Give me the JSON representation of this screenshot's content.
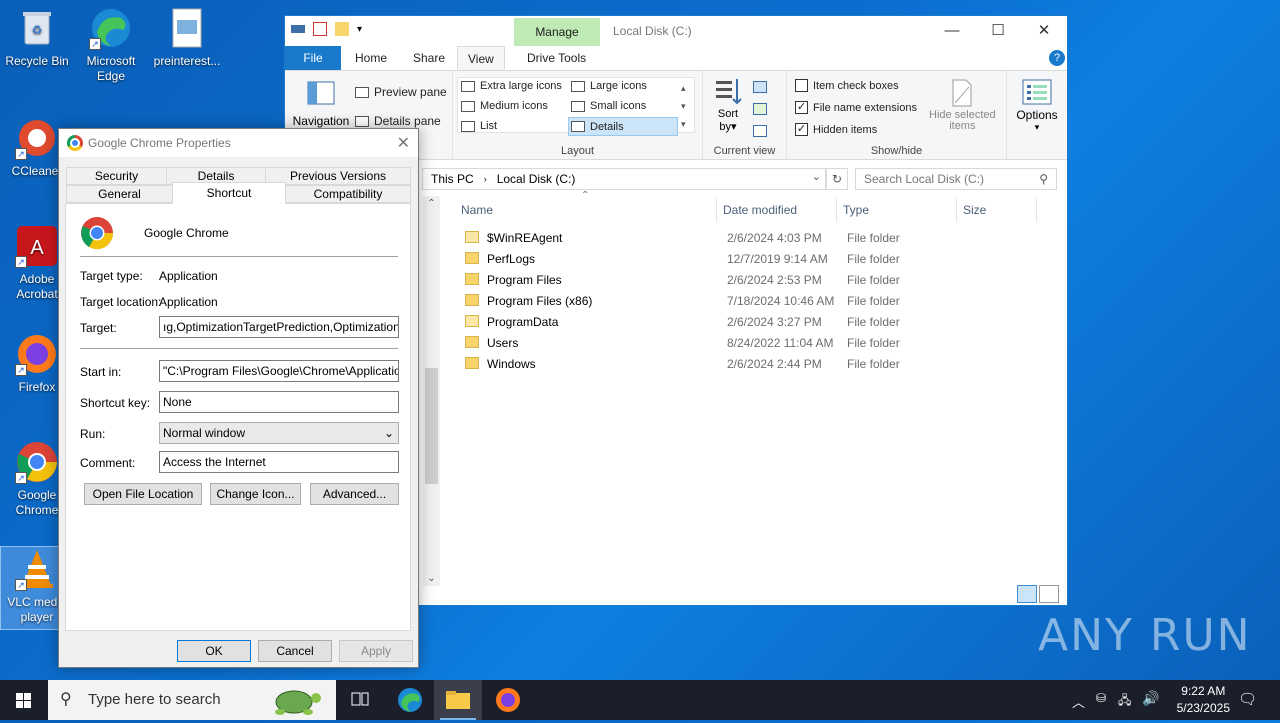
{
  "desktop": {
    "icons": [
      {
        "label": "Recycle Bin"
      },
      {
        "label": "Microsoft Edge"
      },
      {
        "label": "preinterest..."
      },
      {
        "label": "CCleaner"
      },
      {
        "label": "Adobe Acrobat"
      },
      {
        "label": "Firefox"
      },
      {
        "label": "Google Chrome"
      },
      {
        "label": "VLC media player"
      }
    ]
  },
  "explorer": {
    "title": "Local Disk (C:)",
    "manage_tab": "Manage",
    "tabs": [
      "File",
      "Home",
      "Share",
      "View",
      "Drive Tools"
    ],
    "active_tab": "View",
    "ribbon": {
      "panes": {
        "navigation": "Navigation",
        "preview": "Preview pane",
        "details": "Details pane"
      },
      "layout": {
        "label": "Layout",
        "items": [
          "Extra large icons",
          "Large icons",
          "Medium icons",
          "Small icons",
          "List",
          "Details"
        ],
        "selected": "Details"
      },
      "current_view": {
        "label": "Current view",
        "sort": "Sort",
        "sort_by": "by"
      },
      "show_hide": {
        "label": "Show/hide",
        "item_check_boxes": "Item check boxes",
        "file_name_extensions": "File name extensions",
        "hidden_items": "Hidden items",
        "hide_selected": "Hide selected",
        "hide_selected_2": "items",
        "checks": {
          "item_check_boxes": false,
          "file_name_extensions": true,
          "hidden_items": true
        }
      },
      "options": "Options"
    },
    "address": {
      "crumbs": [
        "This PC",
        "Local Disk (C:)"
      ]
    },
    "search_placeholder": "Search Local Disk (C:)",
    "columns": [
      "Name",
      "Date modified",
      "Type",
      "Size"
    ],
    "files": [
      {
        "name": "$WinREAgent",
        "date": "2/6/2024 4:03 PM",
        "type": "File folder",
        "hidden": true
      },
      {
        "name": "PerfLogs",
        "date": "12/7/2019 9:14 AM",
        "type": "File folder",
        "hidden": false
      },
      {
        "name": "Program Files",
        "date": "2/6/2024 2:53 PM",
        "type": "File folder",
        "hidden": false
      },
      {
        "name": "Program Files (x86)",
        "date": "7/18/2024 10:46 AM",
        "type": "File folder",
        "hidden": false
      },
      {
        "name": "ProgramData",
        "date": "2/6/2024 3:27 PM",
        "type": "File folder",
        "hidden": true
      },
      {
        "name": "Users",
        "date": "8/24/2022 11:04 AM",
        "type": "File folder",
        "hidden": false
      },
      {
        "name": "Windows",
        "date": "2/6/2024 2:44 PM",
        "type": "File folder",
        "hidden": false
      }
    ]
  },
  "dialog": {
    "title": "Google Chrome Properties",
    "tabs_row1": [
      "Security",
      "Details",
      "Previous Versions"
    ],
    "tabs_row2": [
      "General",
      "Shortcut",
      "Compatibility"
    ],
    "active_tab": "Shortcut",
    "app_name": "Google Chrome",
    "target_type_label": "Target type:",
    "target_type": "Application",
    "target_location_label": "Target location:",
    "target_location": "Application",
    "target_label": "Target:",
    "target": "ıg,OptimizationTargetPrediction,OptimizationHints\"",
    "start_in_label": "Start in:",
    "start_in": "\"C:\\Program Files\\Google\\Chrome\\Application\"",
    "shortcut_key_label": "Shortcut key:",
    "shortcut_key": "None",
    "run_label": "Run:",
    "run": "Normal window",
    "comment_label": "Comment:",
    "comment": "Access the Internet",
    "buttons": {
      "open_location": "Open File Location",
      "change_icon": "Change Icon...",
      "advanced": "Advanced...",
      "ok": "OK",
      "cancel": "Cancel",
      "apply": "Apply"
    }
  },
  "taskbar": {
    "search_placeholder": "Type here to search",
    "time": "9:22 AM",
    "date": "5/23/2025"
  },
  "watermark": "ANY RUN"
}
